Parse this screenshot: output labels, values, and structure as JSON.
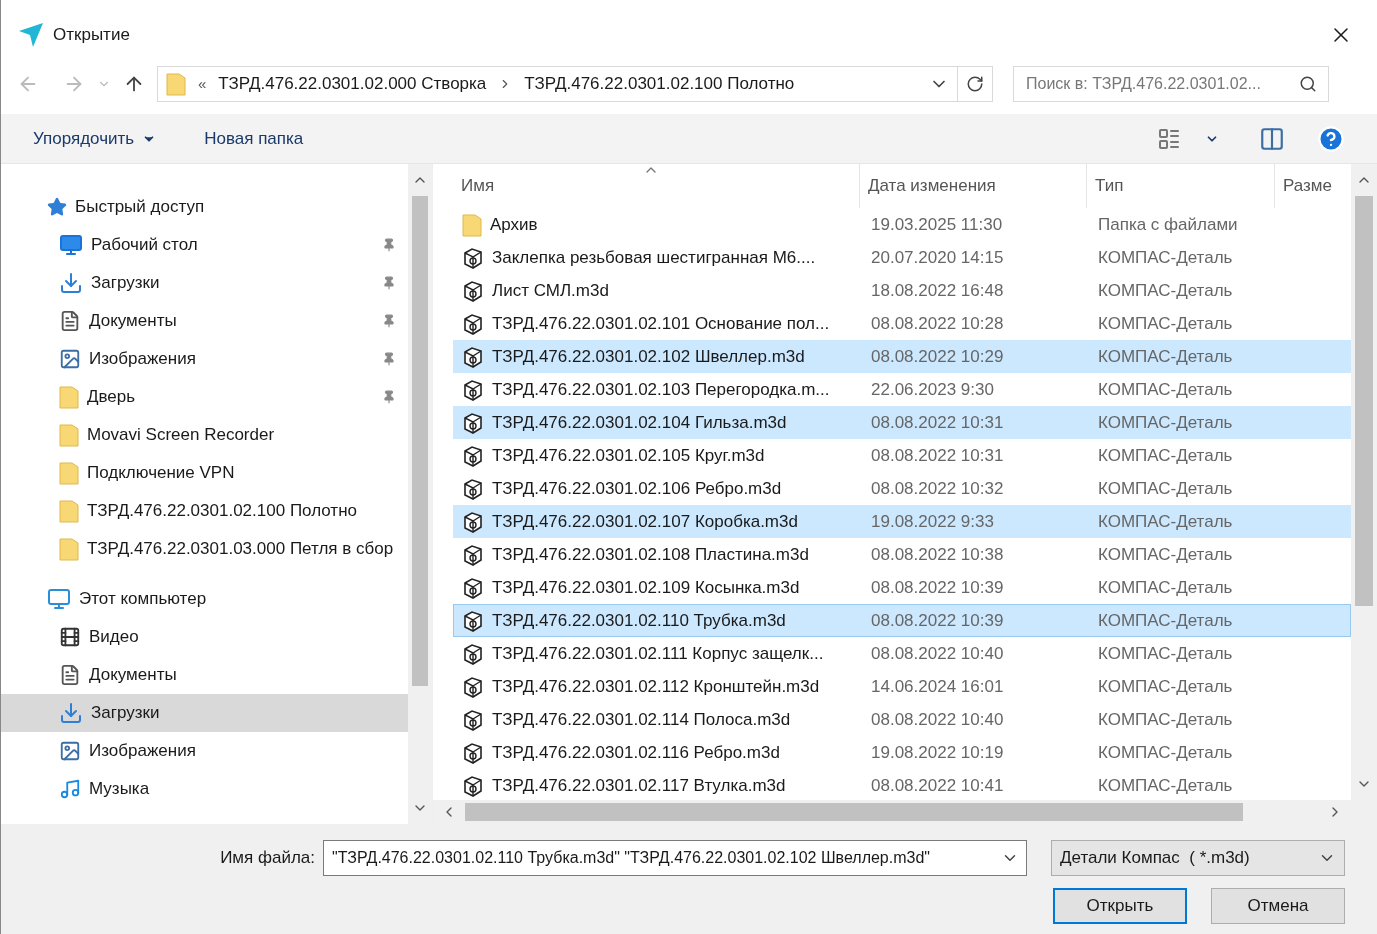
{
  "window": {
    "title": "Открытие"
  },
  "navigation": {
    "path_prefix": "«",
    "breadcrumbs": [
      "ТЗРД.476.22.0301.02.000 Створка",
      "ТЗРД.476.22.0301.02.100 Полотно"
    ],
    "search": {
      "placeholder": "Поиск в: ТЗРД.476.22.0301.02..."
    }
  },
  "toolbar": {
    "organize": "Упорядочить",
    "new_folder": "Новая папка"
  },
  "sidebar": {
    "groups": [
      {
        "label": "Быстрый доступ",
        "kind": "quick",
        "selected": false,
        "children": [
          {
            "label": "Рабочий стол",
            "kind": "desktop",
            "pinned": true,
            "selected": false
          },
          {
            "label": "Загрузки",
            "kind": "downloads",
            "pinned": true,
            "selected": false
          },
          {
            "label": "Документы",
            "kind": "documents",
            "pinned": true,
            "selected": false
          },
          {
            "label": "Изображения",
            "kind": "pictures",
            "pinned": true,
            "selected": false
          },
          {
            "label": "Дверь",
            "kind": "folder",
            "pinned": true,
            "selected": false
          },
          {
            "label": "Movavi Screen Recorder",
            "kind": "folder",
            "pinned": false,
            "selected": false
          },
          {
            "label": "Подключение VPN",
            "kind": "folder",
            "pinned": false,
            "selected": false
          },
          {
            "label": "ТЗРД.476.22.0301.02.100 Полотно",
            "kind": "folder",
            "pinned": false,
            "selected": false
          },
          {
            "label": "ТЗРД.476.22.0301.03.000 Петля в сбор",
            "kind": "folder",
            "pinned": false,
            "selected": false
          }
        ]
      },
      {
        "label": "Этот компьютер",
        "kind": "computer",
        "selected": false,
        "children": [
          {
            "label": "Видео",
            "kind": "video",
            "pinned": false,
            "selected": false
          },
          {
            "label": "Документы",
            "kind": "documents",
            "pinned": false,
            "selected": false
          },
          {
            "label": "Загрузки",
            "kind": "downloads",
            "pinned": false,
            "selected": true
          },
          {
            "label": "Изображения",
            "kind": "pictures",
            "pinned": false,
            "selected": false
          },
          {
            "label": "Музыка",
            "kind": "music",
            "pinned": false,
            "selected": false
          }
        ]
      }
    ]
  },
  "file_list": {
    "columns": [
      "Имя",
      "Дата изменения",
      "Тип",
      "Разме"
    ],
    "rows": [
      {
        "name": "Архив",
        "date": "19.03.2025 11:30",
        "type": "Папка с файлами",
        "kind": "folder",
        "selected": false,
        "focused": false
      },
      {
        "name": "Заклепка резьбовая шестигранная М6....",
        "date": "20.07.2020 14:15",
        "type": "КОМПАС-Деталь",
        "kind": "part",
        "selected": false,
        "focused": false
      },
      {
        "name": "Лист СМЛ.m3d",
        "date": "18.08.2022 16:48",
        "type": "КОМПАС-Деталь",
        "kind": "part",
        "selected": false,
        "focused": false
      },
      {
        "name": "ТЗРД.476.22.0301.02.101 Основание пол...",
        "date": "08.08.2022 10:28",
        "type": "КОМПАС-Деталь",
        "kind": "part",
        "selected": false,
        "focused": false
      },
      {
        "name": "ТЗРД.476.22.0301.02.102 Швеллер.m3d",
        "date": "08.08.2022 10:29",
        "type": "КОМПАС-Деталь",
        "kind": "part",
        "selected": true,
        "focused": false
      },
      {
        "name": "ТЗРД.476.22.0301.02.103 Перегородка.m...",
        "date": "22.06.2023 9:30",
        "type": "КОМПАС-Деталь",
        "kind": "part",
        "selected": false,
        "focused": false
      },
      {
        "name": "ТЗРД.476.22.0301.02.104 Гильза.m3d",
        "date": "08.08.2022 10:31",
        "type": "КОМПАС-Деталь",
        "kind": "part",
        "selected": true,
        "focused": false
      },
      {
        "name": "ТЗРД.476.22.0301.02.105 Круг.m3d",
        "date": "08.08.2022 10:31",
        "type": "КОМПАС-Деталь",
        "kind": "part",
        "selected": false,
        "focused": false
      },
      {
        "name": "ТЗРД.476.22.0301.02.106 Ребро.m3d",
        "date": "08.08.2022 10:32",
        "type": "КОМПАС-Деталь",
        "kind": "part",
        "selected": false,
        "focused": false
      },
      {
        "name": "ТЗРД.476.22.0301.02.107 Коробка.m3d",
        "date": "19.08.2022 9:33",
        "type": "КОМПАС-Деталь",
        "kind": "part",
        "selected": true,
        "focused": false
      },
      {
        "name": "ТЗРД.476.22.0301.02.108 Пластина.m3d",
        "date": "08.08.2022 10:38",
        "type": "КОМПАС-Деталь",
        "kind": "part",
        "selected": false,
        "focused": false
      },
      {
        "name": "ТЗРД.476.22.0301.02.109 Косынка.m3d",
        "date": "08.08.2022 10:39",
        "type": "КОМПАС-Деталь",
        "kind": "part",
        "selected": false,
        "focused": false
      },
      {
        "name": "ТЗРД.476.22.0301.02.110 Трубка.m3d",
        "date": "08.08.2022 10:39",
        "type": "КОМПАС-Деталь",
        "kind": "part",
        "selected": true,
        "focused": true
      },
      {
        "name": "ТЗРД.476.22.0301.02.111 Корпус защелк...",
        "date": "08.08.2022 10:40",
        "type": "КОМПАС-Деталь",
        "kind": "part",
        "selected": false,
        "focused": false
      },
      {
        "name": "ТЗРД.476.22.0301.02.112 Кронштейн.m3d",
        "date": "14.06.2024 16:01",
        "type": "КОМПАС-Деталь",
        "kind": "part",
        "selected": false,
        "focused": false
      },
      {
        "name": "ТЗРД.476.22.0301.02.114 Полоса.m3d",
        "date": "08.08.2022 10:40",
        "type": "КОМПАС-Деталь",
        "kind": "part",
        "selected": false,
        "focused": false
      },
      {
        "name": "ТЗРД.476.22.0301.02.116 Ребро.m3d",
        "date": "19.08.2022 10:19",
        "type": "КОМПАС-Деталь",
        "kind": "part",
        "selected": false,
        "focused": false
      },
      {
        "name": "ТЗРД.476.22.0301.02.117 Втулка.m3d",
        "date": "08.08.2022 10:41",
        "type": "КОМПАС-Деталь",
        "kind": "part",
        "selected": false,
        "focused": false
      }
    ]
  },
  "footer": {
    "filename_label": "Имя файла:",
    "filename_value": "\"ТЗРД.476.22.0301.02.110 Трубка.m3d\" \"ТЗРД.476.22.0301.02.102 Швеллер.m3d\"",
    "filter": "Детали Компас  ( *.m3d)",
    "open": "Открыть",
    "cancel": "Отмена"
  }
}
